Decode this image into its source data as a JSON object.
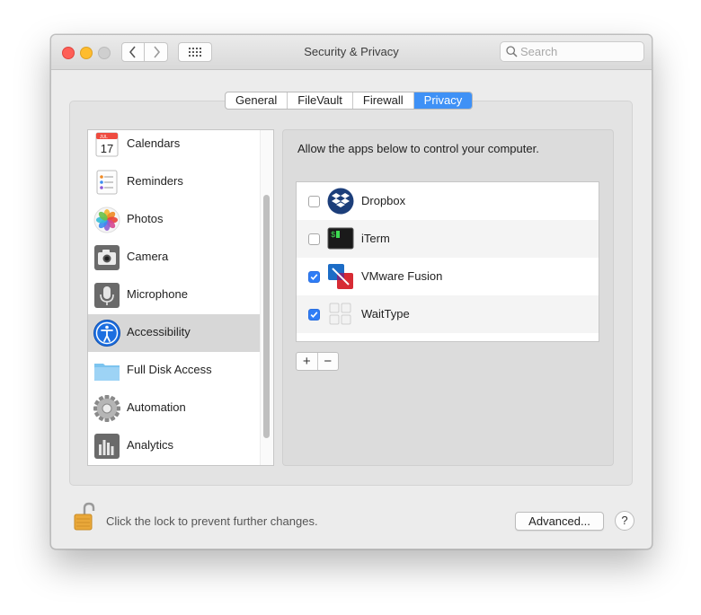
{
  "window": {
    "title": "Security & Privacy"
  },
  "search": {
    "placeholder": "Search",
    "value": ""
  },
  "tabs": [
    {
      "label": "General",
      "active": false
    },
    {
      "label": "FileVault",
      "active": false
    },
    {
      "label": "Firewall",
      "active": false
    },
    {
      "label": "Privacy",
      "active": true
    }
  ],
  "sidebar": {
    "items": [
      {
        "label": "Calendars",
        "icon": "calendar-icon",
        "badge": "17",
        "badge_month": "JUL",
        "selected": false
      },
      {
        "label": "Reminders",
        "icon": "reminders-icon",
        "selected": false
      },
      {
        "label": "Photos",
        "icon": "photos-icon",
        "selected": false
      },
      {
        "label": "Camera",
        "icon": "camera-icon",
        "selected": false
      },
      {
        "label": "Microphone",
        "icon": "microphone-icon",
        "selected": false
      },
      {
        "label": "Accessibility",
        "icon": "accessibility-icon",
        "selected": true
      },
      {
        "label": "Full Disk Access",
        "icon": "folder-icon",
        "selected": false
      },
      {
        "label": "Automation",
        "icon": "gear-icon",
        "selected": false
      },
      {
        "label": "Analytics",
        "icon": "analytics-icon",
        "selected": false
      }
    ]
  },
  "main": {
    "description": "Allow the apps below to control your computer.",
    "apps": [
      {
        "name": "Dropbox",
        "icon": "dropbox-icon",
        "checked": false
      },
      {
        "name": "iTerm",
        "icon": "iterm-icon",
        "icon_text": "$",
        "checked": false
      },
      {
        "name": "VMware Fusion",
        "icon": "vmware-fusion-icon",
        "checked": true
      },
      {
        "name": "WaitType",
        "icon": "waittype-icon",
        "checked": true
      }
    ],
    "add_label": "+",
    "remove_label": "−"
  },
  "footer": {
    "lock_text": "Click the lock to prevent further changes.",
    "advanced_label": "Advanced...",
    "help_label": "?"
  },
  "colors": {
    "accent": "#3f91f6",
    "checkbox_on": "#2f7df6",
    "close": "#fe5f57",
    "minimize": "#febc2e",
    "selection": "#d7d7d7"
  }
}
